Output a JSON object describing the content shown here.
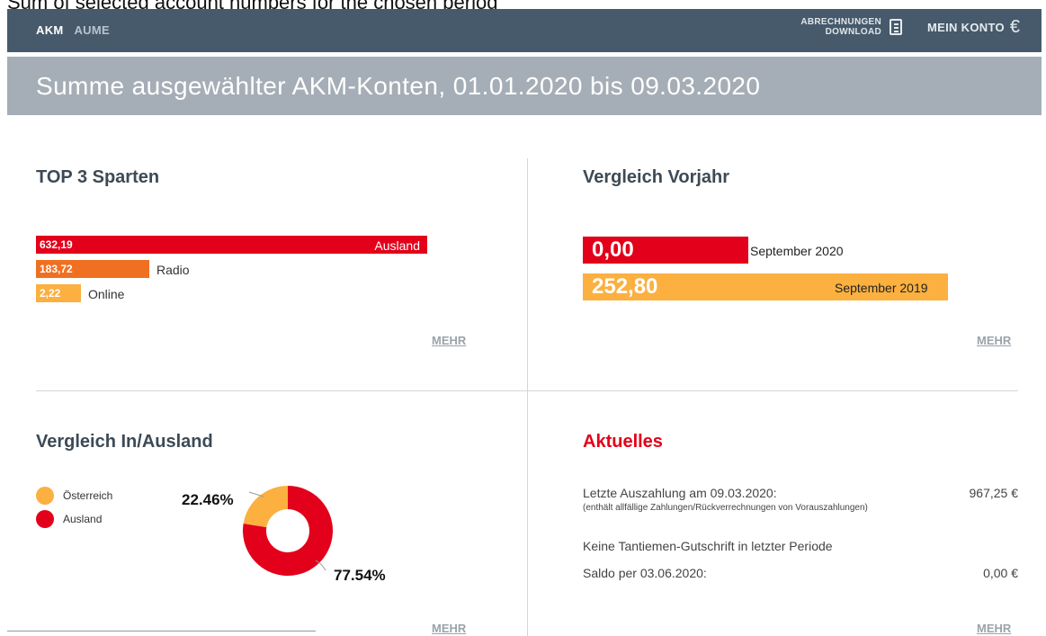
{
  "caption": "Sum of selected account numbers for the chosen period",
  "nav": {
    "tabs": [
      "AKM",
      "AUME"
    ],
    "download_line1": "ABRECHNUNGEN",
    "download_line2": "DOWNLOAD",
    "konto": "MEIN KONTO"
  },
  "banner": {
    "title": "Summe ausgewählter AKM-Konten, 01.01.2020 bis 09.03.2020"
  },
  "top3": {
    "title": "TOP 3 Sparten",
    "items": [
      {
        "value": "632,19",
        "label": "Ausland",
        "amount": 632.19,
        "color": "#e2001a"
      },
      {
        "value": "183,72",
        "label": "Radio",
        "amount": 183.72,
        "color": "#f07022"
      },
      {
        "value": "2,22",
        "label": "Online",
        "amount": 2.22,
        "color": "#fbb040"
      }
    ],
    "more": "MEHR"
  },
  "vorjahr": {
    "title": "Vergleich Vorjahr",
    "items": [
      {
        "value": "0,00",
        "label": "September 2020",
        "color": "#e2001a"
      },
      {
        "value": "252,80",
        "label": "September 2019",
        "color": "#fbb040"
      }
    ],
    "more": "MEHR"
  },
  "inausland": {
    "title": "Vergleich In/Ausland",
    "legend": [
      {
        "label": "Österreich",
        "color": "#fbb040"
      },
      {
        "label": "Ausland",
        "color": "#e2001a"
      }
    ],
    "pct_inland": "22.46%",
    "pct_ausland": "77.54%",
    "inland_share": 22.46,
    "more": "MEHR"
  },
  "aktuelles": {
    "title": "Aktuelles",
    "line1": "Letzte Auszahlung am 09.03.2020:",
    "line1_amount": "967,25 €",
    "line1_sub": "(enthält allfällige Zahlungen/Rückverrechnungen von Vorauszahlungen)",
    "line2": "Keine Tantiemen-Gutschrift in letzter Periode",
    "line3": "Saldo per 03.06.2020:",
    "line3_amount": "0,00 €",
    "more": "MEHR"
  }
}
